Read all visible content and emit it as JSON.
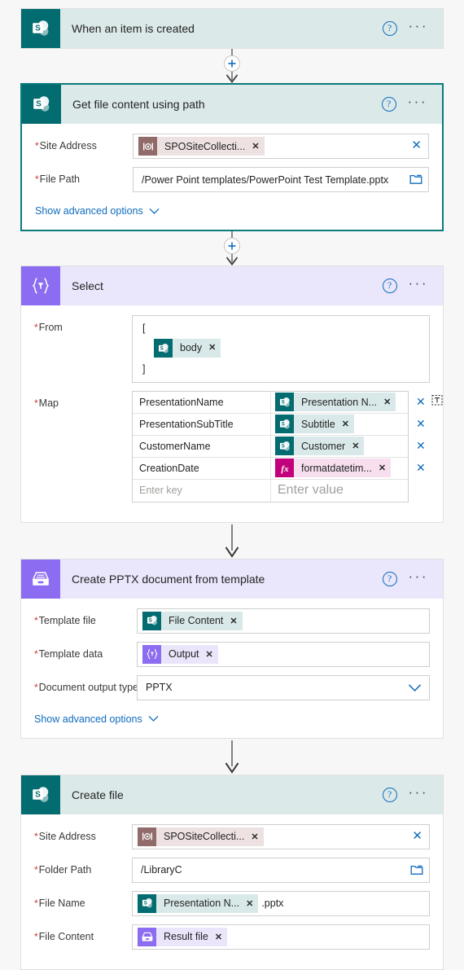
{
  "flow": {
    "nodes": [
      {
        "id": "trigger",
        "title": "When an item is created",
        "icon": "sharepoint-icon",
        "theme": "teal",
        "selected": false,
        "expanded": false,
        "help_label": "?",
        "more_label": "···"
      },
      {
        "id": "get-file-content",
        "title": "Get file content using path",
        "icon": "sharepoint-icon",
        "theme": "teal",
        "selected": true,
        "expanded": true,
        "help_label": "?",
        "more_label": "···",
        "fields": [
          {
            "label": "Site Address",
            "required": true,
            "type": "token",
            "token": {
              "text": "SPOSiteCollecti...",
              "icon": "spo-site-icon",
              "icon_glyph": "[@]",
              "chip": "mauve",
              "remove_label": "✕"
            },
            "clear_label": "✕"
          },
          {
            "label": "File Path",
            "required": true,
            "type": "text",
            "value": "/Power Point templates/PowerPoint Test Template.pptx",
            "trailing_icon": "folder-picker-icon"
          }
        ],
        "show_advanced": "Show advanced options"
      },
      {
        "id": "select",
        "title": "Select",
        "icon": "select-data-operation-icon",
        "icon_glyph": "{∇}",
        "theme": "purple",
        "selected": false,
        "expanded": true,
        "help_label": "?",
        "more_label": "···",
        "from": {
          "label": "From",
          "required": true,
          "open_bracket": "[",
          "close_bracket": "]",
          "token": {
            "text": "body",
            "icon": "sharepoint-icon",
            "chip": "teal",
            "remove_label": "✕"
          }
        },
        "map": {
          "label": "Map",
          "required": true,
          "key_placeholder": "Enter key",
          "value_placeholder": "Enter value",
          "delete_label": "✕",
          "text_mode_label": "T",
          "rows": [
            {
              "key": "PresentationName",
              "value": "Presentation N...",
              "icon": "sharepoint-icon",
              "chip": "teal",
              "remove_label": "✕",
              "has_text_mode": true
            },
            {
              "key": "PresentationSubTitle",
              "value": "Subtitle",
              "icon": "sharepoint-icon",
              "chip": "teal",
              "remove_label": "✕",
              "has_text_mode": false
            },
            {
              "key": "CustomerName",
              "value": "Customer",
              "icon": "sharepoint-icon",
              "chip": "teal",
              "remove_label": "✕",
              "has_text_mode": false
            },
            {
              "key": "CreationDate",
              "value": "formatdatetim...",
              "icon": "expression-fx-icon",
              "icon_glyph": "fx",
              "chip": "pink",
              "remove_label": "✕",
              "has_text_mode": false
            }
          ]
        }
      },
      {
        "id": "create-pptx",
        "title": "Create PPTX document from template",
        "icon": "pptx-template-icon",
        "theme": "purple",
        "selected": false,
        "expanded": true,
        "help_label": "?",
        "more_label": "···",
        "fields": [
          {
            "label": "Template file",
            "required": true,
            "type": "token",
            "token": {
              "text": "File Content",
              "icon": "sharepoint-icon",
              "chip": "teal",
              "remove_label": "✕"
            }
          },
          {
            "label": "Template data",
            "required": true,
            "type": "token",
            "token": {
              "text": "Output",
              "icon": "select-data-operation-icon",
              "icon_glyph": "{∇}",
              "chip": "lav",
              "remove_label": "✕"
            }
          },
          {
            "label": "Document output type",
            "required": true,
            "type": "select",
            "value": "PPTX",
            "trailing_icon": "chevron-down-icon"
          }
        ],
        "show_advanced": "Show advanced options"
      },
      {
        "id": "create-file",
        "title": "Create file",
        "icon": "sharepoint-icon",
        "theme": "teal",
        "selected": false,
        "expanded": true,
        "help_label": "?",
        "more_label": "···",
        "fields": [
          {
            "label": "Site Address",
            "required": true,
            "type": "token",
            "token": {
              "text": "SPOSiteCollecti...",
              "icon": "spo-site-icon",
              "icon_glyph": "[@]",
              "chip": "mauve",
              "remove_label": "✕"
            },
            "clear_label": "✕"
          },
          {
            "label": "Folder Path",
            "required": true,
            "type": "text",
            "value": "/LibraryC",
            "trailing_icon": "folder-picker-icon"
          },
          {
            "label": "File Name",
            "required": true,
            "type": "token",
            "token": {
              "text": "Presentation N...",
              "icon": "sharepoint-icon",
              "chip": "teal",
              "remove_label": "✕"
            },
            "suffix": ".pptx"
          },
          {
            "label": "File Content",
            "required": true,
            "type": "token",
            "token": {
              "text": "Result file",
              "icon": "pptx-template-icon",
              "chip": "lav",
              "remove_label": "✕"
            }
          }
        ]
      }
    ],
    "connectors": [
      {
        "id": "conn-1",
        "has_add_button": true,
        "add_label": "+"
      },
      {
        "id": "conn-2",
        "has_add_button": true,
        "add_label": "+"
      },
      {
        "id": "conn-3",
        "has_add_button": false
      },
      {
        "id": "conn-4",
        "has_add_button": false
      }
    ]
  },
  "colors": {
    "sharepoint_teal": "#036c70",
    "sharepoint_header": "#dce9e9",
    "purple": "#8c6cf0",
    "purple_header": "#eae6fb",
    "link_blue": "#0f6cbd",
    "required_red": "#d13438",
    "fx_magenta": "#c2007b",
    "spo_mauve": "#916a6a",
    "selection_border": "#0b7b7b"
  }
}
